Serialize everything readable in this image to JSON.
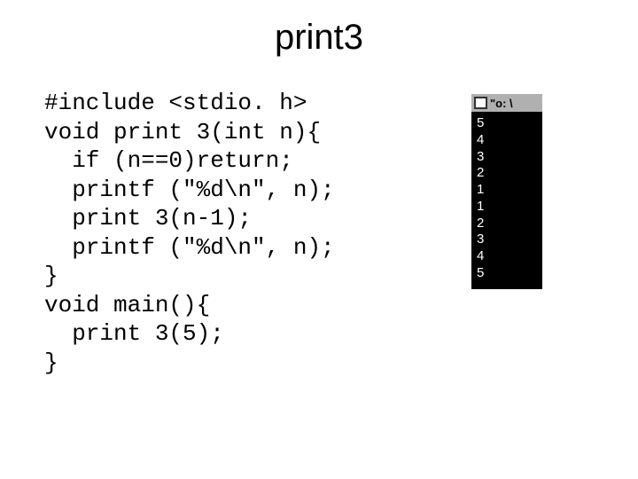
{
  "title": "print3",
  "code": {
    "l0": "#include <stdio. h>",
    "l1": "void print 3(int n){",
    "l2": "  if (n==0)return;",
    "l3": "  printf (\"%d\\n\", n);",
    "l4": "  print 3(n-1);",
    "l5": "  printf (\"%d\\n\", n);",
    "l6": "}",
    "l7": "void main(){",
    "l8": "  print 3(5);",
    "l9": "}"
  },
  "output": {
    "header_text": "\"o: \\",
    "lines": {
      "o0": "5",
      "o1": "4",
      "o2": "3",
      "o3": "2",
      "o4": "1",
      "o5": "1",
      "o6": "2",
      "o7": "3",
      "o8": "4",
      "o9": "5"
    }
  }
}
